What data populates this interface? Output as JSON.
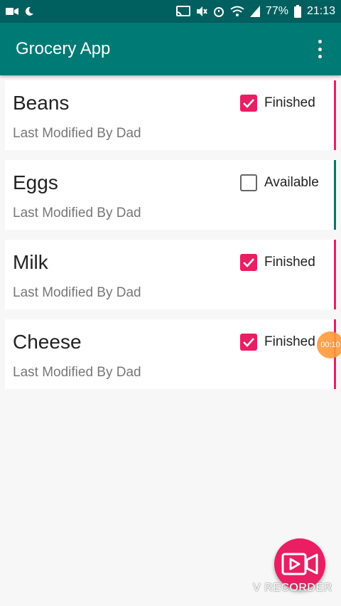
{
  "status_bar": {
    "battery": "77%",
    "time": "21:13"
  },
  "app_bar": {
    "title": "Grocery App"
  },
  "items": [
    {
      "name": "Beans",
      "subtitle": "Last Modified By Dad",
      "status": "Finished",
      "checked": true
    },
    {
      "name": "Eggs",
      "subtitle": "Last Modified By Dad",
      "status": "Available",
      "checked": false
    },
    {
      "name": "Milk",
      "subtitle": "Last Modified By Dad",
      "status": "Finished",
      "checked": true
    },
    {
      "name": "Cheese",
      "subtitle": "Last Modified By Dad",
      "status": "Finished",
      "checked": true
    }
  ],
  "overlay": {
    "recorder_timer": "00:10",
    "watermark": "V RECORDER"
  },
  "colors": {
    "finished_accent": "#e91e63",
    "available_accent": "#00786f",
    "app_bar": "#007a75"
  }
}
